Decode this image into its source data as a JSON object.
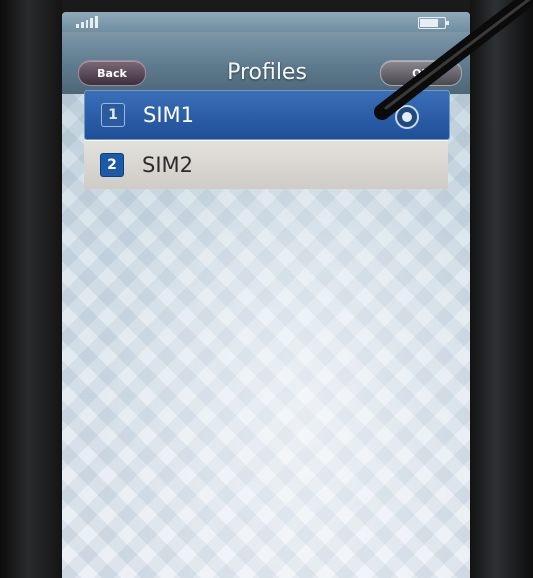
{
  "header": {
    "back_label": "Back",
    "title": "Profiles",
    "ok_label": "OK"
  },
  "profiles": {
    "items": [
      {
        "label": "SIM1",
        "badge": "1",
        "selected": true
      },
      {
        "label": "SIM2",
        "badge": "2",
        "selected": false
      }
    ]
  },
  "icons": {
    "signal": "signal-strength-icon",
    "battery": "battery-icon",
    "selection": "radio-selected-icon"
  },
  "colors": {
    "selected_row": "#2f62ab",
    "unselected_row": "#dcdad5",
    "title_bar": "#5e7a8e"
  }
}
